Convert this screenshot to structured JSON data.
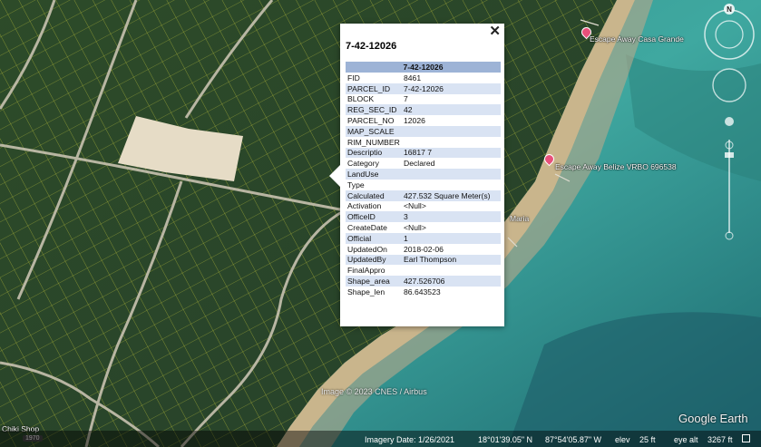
{
  "popup": {
    "title": "7-42-12026",
    "header": "7-42-12026",
    "close_glyph": "✕",
    "fields": [
      {
        "key": "FID",
        "value": "8461"
      },
      {
        "key": "PARCEL_ID",
        "value": "7-42-12026"
      },
      {
        "key": "BLOCK",
        "value": "7"
      },
      {
        "key": "REG_SEC_ID",
        "value": "42"
      },
      {
        "key": "PARCEL_NO",
        "value": "12026"
      },
      {
        "key": "MAP_SCALE",
        "value": ""
      },
      {
        "key": "RIM_NUMBER",
        "value": ""
      },
      {
        "key": "Descriptio",
        "value": "16817 7"
      },
      {
        "key": "Category",
        "value": "Declared"
      },
      {
        "key": "LandUse",
        "value": ""
      },
      {
        "key": "Type",
        "value": ""
      },
      {
        "key": "Calculated",
        "value": "427.532 Square Meter(s)"
      },
      {
        "key": "Activation",
        "value": "<Null>"
      },
      {
        "key": "OfficeID",
        "value": "3"
      },
      {
        "key": "CreateDate",
        "value": "<Null>"
      },
      {
        "key": "Official",
        "value": "1"
      },
      {
        "key": "UpdatedOn",
        "value": "2018-02-06"
      },
      {
        "key": "UpdatedBy",
        "value": "Earl Thompson"
      },
      {
        "key": "FinalAppro",
        "value": ""
      },
      {
        "key": "Shape_area",
        "value": "427.526706"
      },
      {
        "key": "Shape_len",
        "value": "86.643523"
      }
    ],
    "header_color": "#9db3d6",
    "alt_row_color": "#d9e3f3"
  },
  "places": {
    "casa_grande": "Escape Away Casa Grande",
    "vrbo": "Escape Away Belize VRBO 696538",
    "maria": "Maria",
    "chiki": "Chiki Shop"
  },
  "compass": {
    "north": "N"
  },
  "credit": "Image © 2023 CNES / Airbus",
  "logo": "Google Earth",
  "year_badge": "1970",
  "status": {
    "imagery_date": "Imagery Date: 1/26/2021",
    "lat": "18°01'39.05\" N",
    "lon": "87°54'05.87\" W",
    "elev_label": "elev",
    "elev": "25 ft",
    "eye_alt_label": "eye alt",
    "eye_alt": "3267 ft"
  },
  "colors": {
    "vegetation": "#2c4a28",
    "sea_shallow": "#3fa8a0",
    "sea_deep": "#1d5a66",
    "sand": "#c9b58c",
    "parcel_lines": "#e4e23c",
    "pin": "#e8507a"
  }
}
